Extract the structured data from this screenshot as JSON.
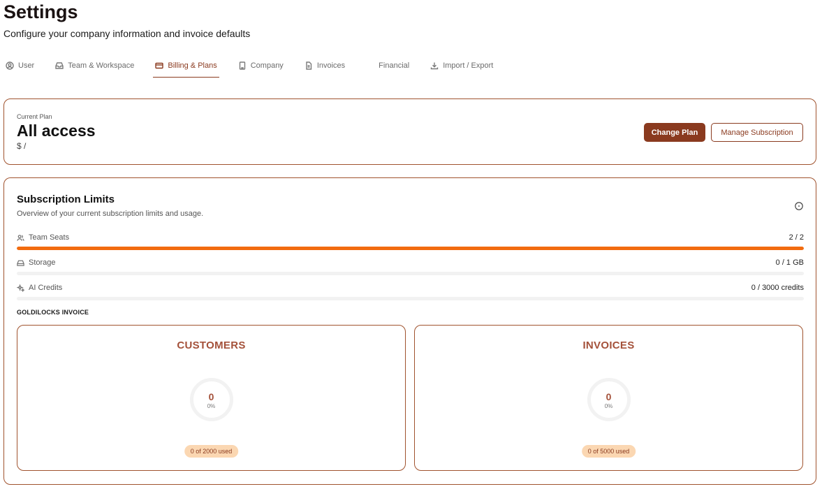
{
  "header": {
    "title": "Settings",
    "subtitle": "Configure your company information and invoice defaults"
  },
  "tabs": [
    {
      "label": "User",
      "icon": "user-circle-icon"
    },
    {
      "label": "Team & Workspace",
      "icon": "inbox-icon"
    },
    {
      "label": "Billing & Plans",
      "icon": "credit-card-icon",
      "active": true
    },
    {
      "label": "Company",
      "icon": "building-icon"
    },
    {
      "label": "Invoices",
      "icon": "document-icon"
    },
    {
      "label": "Financial",
      "icon": null
    },
    {
      "label": "Import / Export",
      "icon": "download-icon"
    }
  ],
  "plan": {
    "label": "Current Plan",
    "name": "All access",
    "price": "$ /",
    "change_label": "Change Plan",
    "manage_label": "Manage Subscription"
  },
  "limits": {
    "title": "Subscription Limits",
    "description": "Overview of your current subscription limits and usage.",
    "items": [
      {
        "label": "Team Seats",
        "value": "2 / 2",
        "icon": "users-icon",
        "fraction": 1.0
      },
      {
        "label": "Storage",
        "value": "0 / 1 GB",
        "icon": "hard-drive-icon",
        "fraction": 0.0
      },
      {
        "label": "AI Credits",
        "value": "0 / 3000 credits",
        "icon": "sparkles-icon",
        "fraction": 0.0
      }
    ],
    "section_label": "GOLDILOCKS INVOICE",
    "metrics": [
      {
        "title": "CUSTOMERS",
        "value": "0",
        "percent": "0%",
        "used": "0 of 2000 used"
      },
      {
        "title": "INVOICES",
        "value": "0",
        "percent": "0%",
        "used": "0 of 5000 used"
      }
    ]
  },
  "colors": {
    "accent": "#8a3a1f",
    "progress": "#f26b0f",
    "pill": "#fbd7b2"
  }
}
